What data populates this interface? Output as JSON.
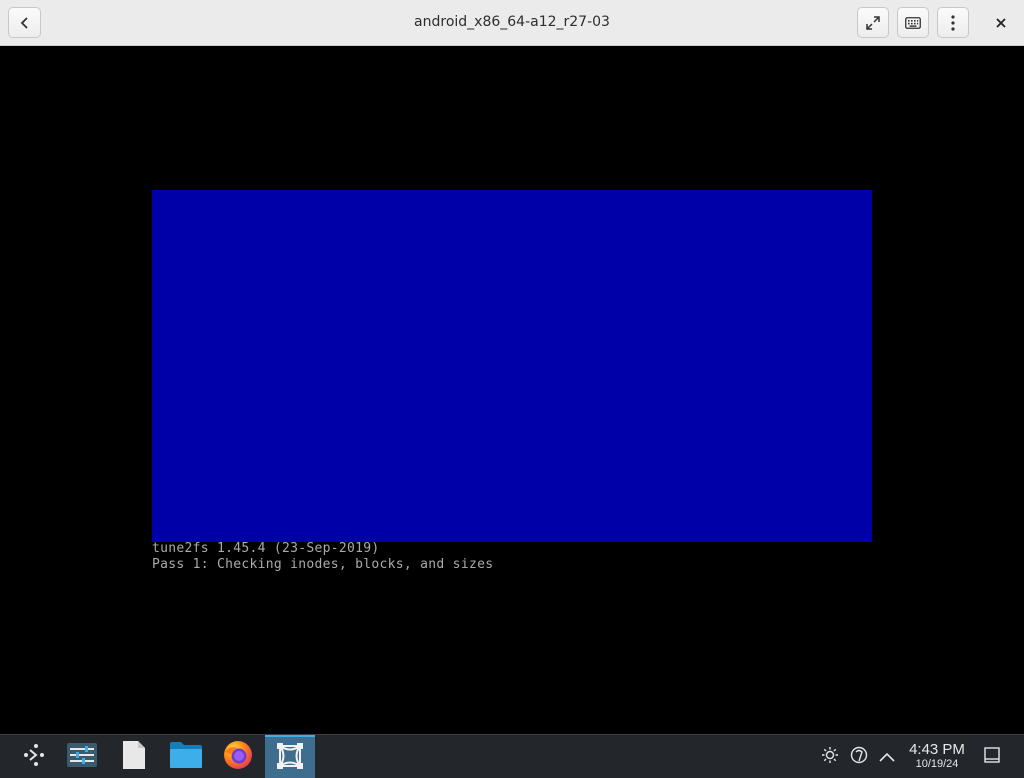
{
  "window": {
    "title": "android_x86_64-a12_r27-03",
    "buttons": {
      "back_icon": "chevron-left-icon",
      "fullscreen_icon": "fullscreen-icon",
      "keyboard_icon": "keyboard-icon",
      "menu_icon": "kebab-menu-icon",
      "close_icon": "close-icon"
    }
  },
  "console": {
    "box_color": "#0000a8",
    "text_color": "#aaaaaa",
    "lines": [
      "tune2fs 1.45.4 (23-Sep-2019)",
      "Pass 1: Checking inodes, blocks, and sizes"
    ]
  },
  "taskbar": {
    "apps": [
      {
        "icon": "app-launcher-icon"
      },
      {
        "icon": "system-settings-icon"
      },
      {
        "icon": "text-file-icon"
      },
      {
        "icon": "file-manager-icon"
      },
      {
        "icon": "firefox-icon"
      },
      {
        "icon": "virtual-machine-icon",
        "active": true
      }
    ],
    "tray": [
      "brightness-icon",
      "network-icon",
      "expand-tray-icon"
    ],
    "clock": {
      "time": "4:43 PM",
      "date": "10/19/24"
    },
    "show_desktop_icon": "show-desktop-icon",
    "accent": "#3daee9"
  }
}
